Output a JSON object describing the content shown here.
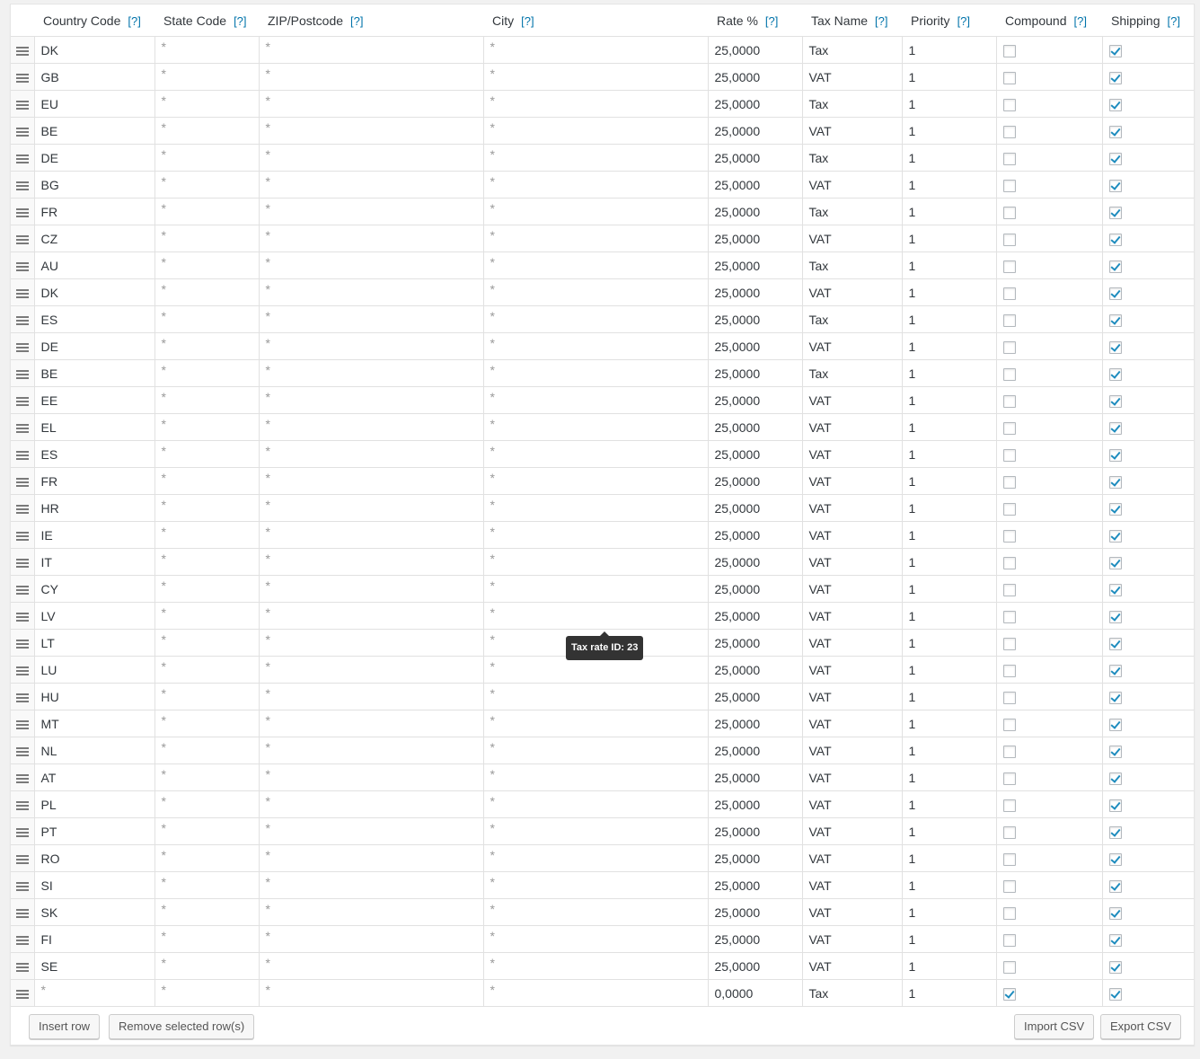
{
  "headers": {
    "country": "Country Code",
    "state": "State Code",
    "zip": "ZIP/Postcode",
    "city": "City",
    "rate": "Rate %",
    "name": "Tax Name",
    "priority": "Priority",
    "compound": "Compound",
    "shipping": "Shipping",
    "help": "[?]"
  },
  "rows": [
    {
      "country": "DK",
      "state": "*",
      "zip": "*",
      "city": "*",
      "rate": "25,0000",
      "name": "Tax",
      "priority": "1",
      "compound": false,
      "shipping": true
    },
    {
      "country": "GB",
      "state": "*",
      "zip": "*",
      "city": "*",
      "rate": "25,0000",
      "name": "VAT",
      "priority": "1",
      "compound": false,
      "shipping": true
    },
    {
      "country": "EU",
      "state": "*",
      "zip": "*",
      "city": "*",
      "rate": "25,0000",
      "name": "Tax",
      "priority": "1",
      "compound": false,
      "shipping": true
    },
    {
      "country": "BE",
      "state": "*",
      "zip": "*",
      "city": "*",
      "rate": "25,0000",
      "name": "VAT",
      "priority": "1",
      "compound": false,
      "shipping": true
    },
    {
      "country": "DE",
      "state": "*",
      "zip": "*",
      "city": "*",
      "rate": "25,0000",
      "name": "Tax",
      "priority": "1",
      "compound": false,
      "shipping": true
    },
    {
      "country": "BG",
      "state": "*",
      "zip": "*",
      "city": "*",
      "rate": "25,0000",
      "name": "VAT",
      "priority": "1",
      "compound": false,
      "shipping": true
    },
    {
      "country": "FR",
      "state": "*",
      "zip": "*",
      "city": "*",
      "rate": "25,0000",
      "name": "Tax",
      "priority": "1",
      "compound": false,
      "shipping": true
    },
    {
      "country": "CZ",
      "state": "*",
      "zip": "*",
      "city": "*",
      "rate": "25,0000",
      "name": "VAT",
      "priority": "1",
      "compound": false,
      "shipping": true
    },
    {
      "country": "AU",
      "state": "*",
      "zip": "*",
      "city": "*",
      "rate": "25,0000",
      "name": "Tax",
      "priority": "1",
      "compound": false,
      "shipping": true
    },
    {
      "country": "DK",
      "state": "*",
      "zip": "*",
      "city": "*",
      "rate": "25,0000",
      "name": "VAT",
      "priority": "1",
      "compound": false,
      "shipping": true
    },
    {
      "country": "ES",
      "state": "*",
      "zip": "*",
      "city": "*",
      "rate": "25,0000",
      "name": "Tax",
      "priority": "1",
      "compound": false,
      "shipping": true
    },
    {
      "country": "DE",
      "state": "*",
      "zip": "*",
      "city": "*",
      "rate": "25,0000",
      "name": "VAT",
      "priority": "1",
      "compound": false,
      "shipping": true
    },
    {
      "country": "BE",
      "state": "*",
      "zip": "*",
      "city": "*",
      "rate": "25,0000",
      "name": "Tax",
      "priority": "1",
      "compound": false,
      "shipping": true
    },
    {
      "country": "EE",
      "state": "*",
      "zip": "*",
      "city": "*",
      "rate": "25,0000",
      "name": "VAT",
      "priority": "1",
      "compound": false,
      "shipping": true
    },
    {
      "country": "EL",
      "state": "*",
      "zip": "*",
      "city": "*",
      "rate": "25,0000",
      "name": "VAT",
      "priority": "1",
      "compound": false,
      "shipping": true
    },
    {
      "country": "ES",
      "state": "*",
      "zip": "*",
      "city": "*",
      "rate": "25,0000",
      "name": "VAT",
      "priority": "1",
      "compound": false,
      "shipping": true
    },
    {
      "country": "FR",
      "state": "*",
      "zip": "*",
      "city": "*",
      "rate": "25,0000",
      "name": "VAT",
      "priority": "1",
      "compound": false,
      "shipping": true
    },
    {
      "country": "HR",
      "state": "*",
      "zip": "*",
      "city": "*",
      "rate": "25,0000",
      "name": "VAT",
      "priority": "1",
      "compound": false,
      "shipping": true
    },
    {
      "country": "IE",
      "state": "*",
      "zip": "*",
      "city": "*",
      "rate": "25,0000",
      "name": "VAT",
      "priority": "1",
      "compound": false,
      "shipping": true
    },
    {
      "country": "IT",
      "state": "*",
      "zip": "*",
      "city": "*",
      "rate": "25,0000",
      "name": "VAT",
      "priority": "1",
      "compound": false,
      "shipping": true
    },
    {
      "country": "CY",
      "state": "*",
      "zip": "*",
      "city": "*",
      "rate": "25,0000",
      "name": "VAT",
      "priority": "1",
      "compound": false,
      "shipping": true
    },
    {
      "country": "LV",
      "state": "*",
      "zip": "*",
      "city": "*",
      "rate": "25,0000",
      "name": "VAT",
      "priority": "1",
      "compound": false,
      "shipping": true
    },
    {
      "country": "LT",
      "state": "*",
      "zip": "*",
      "city": "*",
      "rate": "25,0000",
      "name": "VAT",
      "priority": "1",
      "compound": false,
      "shipping": true
    },
    {
      "country": "LU",
      "state": "*",
      "zip": "*",
      "city": "*",
      "rate": "25,0000",
      "name": "VAT",
      "priority": "1",
      "compound": false,
      "shipping": true
    },
    {
      "country": "HU",
      "state": "*",
      "zip": "*",
      "city": "*",
      "rate": "25,0000",
      "name": "VAT",
      "priority": "1",
      "compound": false,
      "shipping": true
    },
    {
      "country": "MT",
      "state": "*",
      "zip": "*",
      "city": "*",
      "rate": "25,0000",
      "name": "VAT",
      "priority": "1",
      "compound": false,
      "shipping": true
    },
    {
      "country": "NL",
      "state": "*",
      "zip": "*",
      "city": "*",
      "rate": "25,0000",
      "name": "VAT",
      "priority": "1",
      "compound": false,
      "shipping": true
    },
    {
      "country": "AT",
      "state": "*",
      "zip": "*",
      "city": "*",
      "rate": "25,0000",
      "name": "VAT",
      "priority": "1",
      "compound": false,
      "shipping": true
    },
    {
      "country": "PL",
      "state": "*",
      "zip": "*",
      "city": "*",
      "rate": "25,0000",
      "name": "VAT",
      "priority": "1",
      "compound": false,
      "shipping": true
    },
    {
      "country": "PT",
      "state": "*",
      "zip": "*",
      "city": "*",
      "rate": "25,0000",
      "name": "VAT",
      "priority": "1",
      "compound": false,
      "shipping": true
    },
    {
      "country": "RO",
      "state": "*",
      "zip": "*",
      "city": "*",
      "rate": "25,0000",
      "name": "VAT",
      "priority": "1",
      "compound": false,
      "shipping": true
    },
    {
      "country": "SI",
      "state": "*",
      "zip": "*",
      "city": "*",
      "rate": "25,0000",
      "name": "VAT",
      "priority": "1",
      "compound": false,
      "shipping": true
    },
    {
      "country": "SK",
      "state": "*",
      "zip": "*",
      "city": "*",
      "rate": "25,0000",
      "name": "VAT",
      "priority": "1",
      "compound": false,
      "shipping": true
    },
    {
      "country": "FI",
      "state": "*",
      "zip": "*",
      "city": "*",
      "rate": "25,0000",
      "name": "VAT",
      "priority": "1",
      "compound": false,
      "shipping": true
    },
    {
      "country": "SE",
      "state": "*",
      "zip": "*",
      "city": "*",
      "rate": "25,0000",
      "name": "VAT",
      "priority": "1",
      "compound": false,
      "shipping": true
    },
    {
      "country": "*",
      "state": "*",
      "zip": "*",
      "city": "*",
      "rate": "0,0000",
      "name": "Tax",
      "priority": "1",
      "compound": true,
      "shipping": true
    }
  ],
  "tooltip": "Tax rate ID: 23",
  "buttons": {
    "insert": "Insert row",
    "remove": "Remove selected row(s)",
    "import": "Import CSV",
    "export": "Export CSV"
  },
  "icons": {
    "drag_handle": "drag-handle-icon",
    "checkbox": "checkbox-icon"
  },
  "colors": {
    "link": "#0073aa",
    "checkmark": "#1e8cbe",
    "tooltip_bg": "#333333"
  }
}
